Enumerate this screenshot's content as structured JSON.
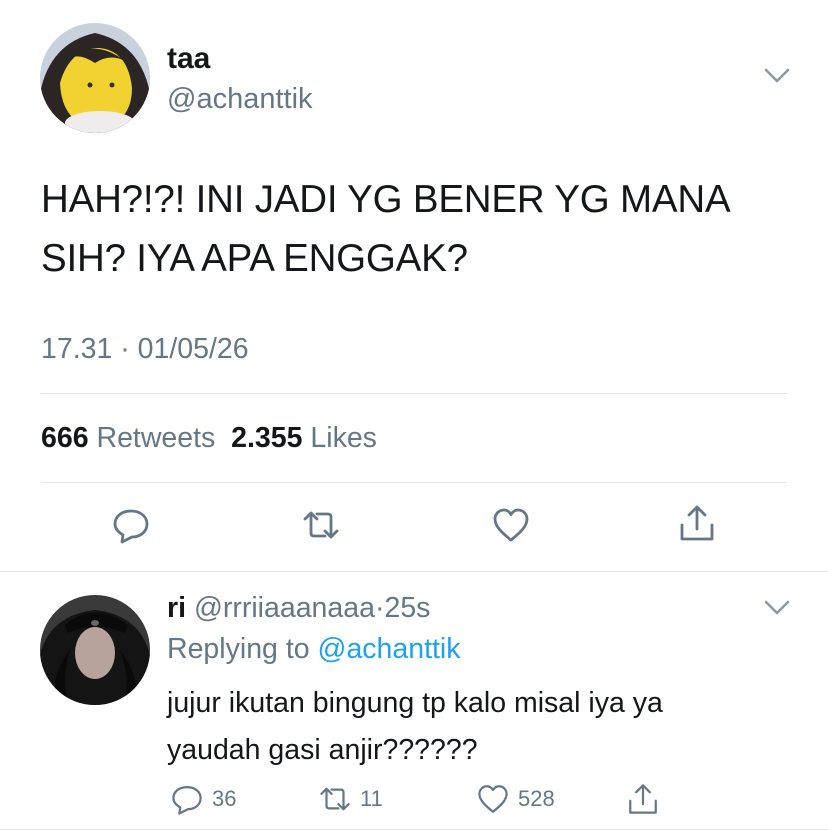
{
  "main_tweet": {
    "author_name": "taa",
    "author_handle": "@achanttik",
    "text_line1": "HAH?!?! INI JADI YG BENER YG MANA",
    "text_line2": "SIH? IYA APA ENGGAK?",
    "timestamp": "17.31 · 01/05/26",
    "retweet_count": "666",
    "retweet_label": "Retweets",
    "like_count": "2.355",
    "like_label": "Likes",
    "actions": [
      "reply-icon",
      "retweet-icon",
      "like-icon",
      "share-icon"
    ]
  },
  "reply": {
    "author_name": "ri",
    "author_handle": "@rrriiaaanaaa",
    "time_sep": "·",
    "time": "25s",
    "replying_prefix": "Replying to",
    "replying_to": "@achanttik",
    "text_line1": "jujur ikutan bingung tp kalo misal iya ya",
    "text_line2": "yaudah gasi anjir??????",
    "reply_count": "36",
    "retweet_count": "11",
    "like_count": "528"
  },
  "colors": {
    "text": "#14171a",
    "secondary": "#657786",
    "link": "#1da1f2",
    "divider": "#e1e8ed"
  }
}
